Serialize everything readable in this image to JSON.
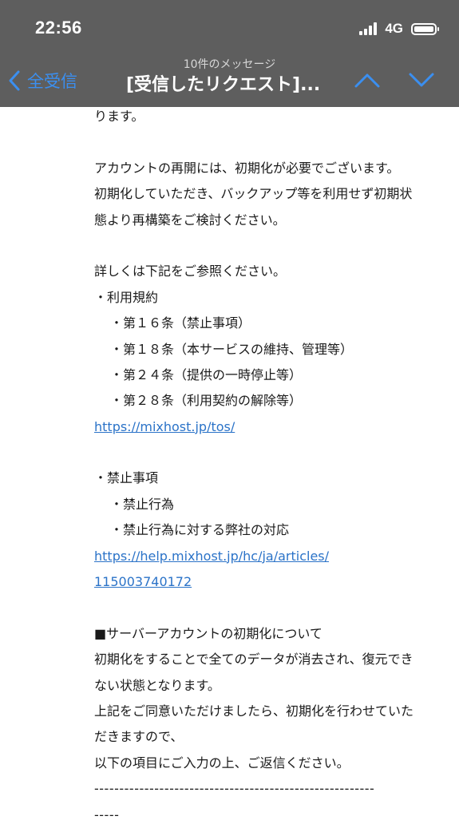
{
  "status": {
    "time": "22:56",
    "network": "4G"
  },
  "header": {
    "back_label": "全受信",
    "subtitle": "10件のメッセージ",
    "title": "[受信したリクエスト]..."
  },
  "body": {
    "lines": [
      "ります。",
      "",
      "アカウントの再開には、初期化が必要でございます。",
      "初期化していただき、バックアップ等を利用せず初期状",
      "態より再構築をご検討ください。",
      "",
      "詳しくは下記をご参照ください。",
      "・利用規約",
      "・第１６条（禁止事項）",
      "・第１８条（本サービスの維持、管理等）",
      "・第２４条（提供の一時停止等）",
      "・第２８条（利用契約の解除等）",
      "https://mixhost.jp/tos/",
      "",
      "・禁止事項",
      "・禁止行為",
      "・禁止行為に対する弊社の対応",
      "https://help.mixhost.jp/hc/ja/articles/",
      "115003740172",
      "",
      "■サーバーアカウントの初期化について",
      "初期化をすることで全てのデータが消去され、復元でき",
      "ない状態となります。",
      "上記をご同意いただけましたら、初期化を行わせていた",
      "だきますので、",
      "以下の項目にご入力の上、ご返信ください。",
      "--------------------------------------------------------",
      "-----"
    ]
  }
}
